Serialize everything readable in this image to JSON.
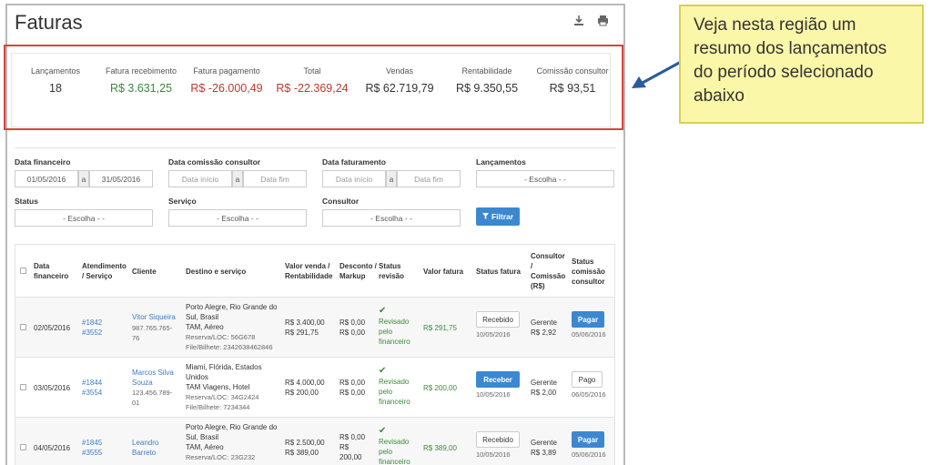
{
  "page": {
    "title": "Faturas"
  },
  "summary": {
    "items": [
      {
        "label": "Lançamentos",
        "value": "18",
        "tone": "neutral"
      },
      {
        "label": "Fatura recebimento",
        "value": "R$ 3.631,25",
        "tone": "green"
      },
      {
        "label": "Fatura pagamento",
        "value": "R$ -26.000,49",
        "tone": "red"
      },
      {
        "label": "Total",
        "value": "R$ -22.369,24",
        "tone": "red"
      },
      {
        "label": "Vendas",
        "value": "R$ 62.719,79",
        "tone": "neutral"
      },
      {
        "label": "Rentabilidade",
        "value": "R$ 9.350,55",
        "tone": "neutral"
      },
      {
        "label": "Comissão consultor",
        "value": "R$ 93,51",
        "tone": "neutral"
      }
    ]
  },
  "filters": {
    "data_financeiro": {
      "label": "Data financeiro",
      "start": "01/05/2016",
      "sep": "a",
      "end": "31/05/2016"
    },
    "data_comissao": {
      "label": "Data comissão consultor",
      "start_ph": "Data início",
      "sep": "a",
      "end_ph": "Data fim"
    },
    "data_faturamento": {
      "label": "Data faturamento",
      "start_ph": "Data início",
      "sep": "a",
      "end_ph": "Data fim"
    },
    "lancamentos": {
      "label": "Lançamentos",
      "value": "- Escolha - -"
    },
    "status": {
      "label": "Status",
      "value": "- Escolha - -"
    },
    "servico": {
      "label": "Serviço",
      "value": "- Escolha - -"
    },
    "consultor": {
      "label": "Consultor",
      "value": "- Escolha - -"
    },
    "filter_button": "Filtrar"
  },
  "table": {
    "headers": {
      "data": "Data financeiro",
      "atendimento": "Atendimento / Serviço",
      "cliente": "Cliente",
      "destino": "Destino e serviço",
      "valor": "Valor venda / Rentabilidade",
      "desconto": "Desconto / Markup",
      "status_revisao": "Status revisão",
      "valor_fatura": "Valor fatura",
      "status_fatura": "Status fatura",
      "consultor": "Consultor / Comissão (R$)",
      "status_comissao": "Status comissão consultor"
    },
    "rows": [
      {
        "data": "02/05/2016",
        "atend1": "#1842",
        "atend2": "#3552",
        "cliente1": "Vitor Siqueira",
        "cliente2": "987.765.765-",
        "cliente3": "76",
        "dest1": "Porto Alegre, Rio Grande do",
        "dest2": "Sul, Brasil",
        "dest3": "TAM, Aéreo",
        "dest4": "Reserva/LOC: 56G678",
        "dest5": "File/Bilhete: 2342638462846",
        "valor1": "R$ 3.400,00",
        "valor2": "R$ 291,75",
        "desc1": "R$ 0,00",
        "desc2": "R$ 0,00",
        "rev1": "Revisado",
        "rev2": "pelo",
        "rev3": "financeiro",
        "fatura": "R$ 291,75",
        "status_fatura": "Recebido",
        "status_fatura_date": "10/05/2016",
        "consultor": "Gerente",
        "comissao": "R$ 2,92",
        "status_comissao": "Pagar",
        "status_comissao_date": "05/06/2016"
      },
      {
        "data": "03/05/2016",
        "atend1": "#1844",
        "atend2": "#3554",
        "cliente1": "Marcos Silva",
        "cliente2": "Souza",
        "cliente3": "123.456.789-",
        "cliente4": "01",
        "dest1": "Miami, Flórida, Estados",
        "dest2": "Unidos",
        "dest3": "TAM Viagens, Hotel",
        "dest4": "Reserva/LOC: 34G2424",
        "dest5": "File/Bilhete: 7234344",
        "valor1": "R$ 4.000,00",
        "valor2": "R$ 200,00",
        "desc1": "R$ 0,00",
        "desc2": "R$ 0,00",
        "rev1": "Revisado",
        "rev2": "pelo",
        "rev3": "financeiro",
        "fatura": "R$ 200,00",
        "status_fatura": "Receber",
        "status_fatura_date": "10/05/2016",
        "consultor": "Gerente",
        "comissao": "R$ 2,00",
        "status_comissao": "Pago",
        "status_comissao_date": "06/05/2016"
      },
      {
        "data": "04/05/2016",
        "atend1": "#1845",
        "atend2": "#3555",
        "cliente1": "Leandro",
        "cliente2": "Barreto",
        "dest1": "Porto Alegre, Rio Grande do",
        "dest2": "Sul, Brasil",
        "dest3": "TAM, Aéreo",
        "dest4": "Reserva/LOC: 23G232",
        "valor1": "R$ 2.500,00",
        "valor2": "R$ 389,00",
        "desc1": "R$ 0,00",
        "desc2": "R$",
        "desc3": "200,00",
        "rev1": "Revisado",
        "rev2": "pelo",
        "rev3": "financeiro",
        "fatura": "R$ 389,00",
        "status_fatura": "Recebido",
        "status_fatura_date": "10/05/2016",
        "consultor": "Gerente",
        "comissao": "R$ 3,89",
        "status_comissao": "Pagar",
        "status_comissao_date": "05/06/2016"
      }
    ]
  },
  "note": {
    "text": "Veja nesta região um resumo dos lançamentos do período selecionado abaixo"
  },
  "colors": {
    "accent": "#3c88d0",
    "highlight_border": "#d9443d",
    "note_bg": "#fbf7a8",
    "arrow": "#2a5aa0"
  }
}
